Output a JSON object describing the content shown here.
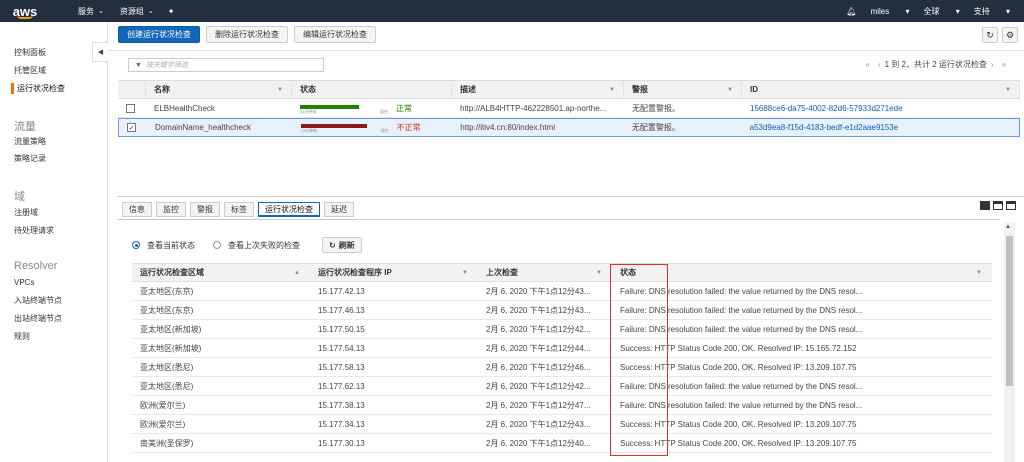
{
  "topnav": {
    "logo": "aws",
    "services": "服务",
    "resource_groups": "资源组",
    "user": "miles",
    "region": "全球",
    "support": "支持"
  },
  "sidebar": {
    "items": [
      {
        "label": "控制面板"
      },
      {
        "label": "托管区域"
      },
      {
        "label": "运行状况检查"
      },
      {
        "label": "流量策略"
      },
      {
        "label": "策略记录"
      },
      {
        "label": "注册域"
      },
      {
        "label": "待处理请求"
      },
      {
        "label": "VPCs"
      },
      {
        "label": "入站终端节点"
      },
      {
        "label": "出站终端节点"
      },
      {
        "label": "规则"
      }
    ],
    "sections": [
      "流量",
      "域",
      "Resolver"
    ]
  },
  "toolbar": {
    "create": "创建运行状况检查",
    "delete": "删除运行状况检查",
    "edit": "编辑运行状况检查"
  },
  "filter": {
    "placeholder": "按关键字筛选"
  },
  "pager": {
    "text": "1 到 2，共计 2 运行状况检查"
  },
  "top_table": {
    "headers": [
      "名称",
      "状态",
      "描述",
      "警报",
      "ID"
    ],
    "rows": [
      {
        "name": "ELBHealthCheck",
        "bar_left": "31分钟前",
        "bar_right": "现在",
        "status": "正常",
        "desc": "http://ALB4HTTP-462228501.ap-northe...",
        "alarm": "无配置警报。",
        "id": "15688ce6-da75-4002-82d6-57933d271ede",
        "health": 0.9,
        "color": "#1d8102",
        "checked": false
      },
      {
        "name": "DomainName_healthcheck",
        "bar_left": "15分钟前",
        "bar_right": "现在",
        "status": "不正常",
        "desc": "http://itiv4.cn:80/index.html",
        "alarm": "无配置警报。",
        "id": "a53d9ea8-f15d-4183-bedf-e1d2aae9153e",
        "health": 0.0,
        "color": "#8b1a1a",
        "checked": true
      }
    ]
  },
  "tabs": [
    "信息",
    "监控",
    "警报",
    "标签",
    "运行状况检查",
    "延迟"
  ],
  "radios": {
    "current": "查看当前状态",
    "last_fail": "查看上次失败的检查",
    "refresh": "刷新"
  },
  "bottom_table": {
    "headers": [
      "运行状况检查区域",
      "运行状况检查程序 IP",
      "上次检查",
      "状态"
    ],
    "rows": [
      {
        "region": "亚太地区(东京)",
        "ip": "15.177.42.13",
        "last": "2月 6, 2020 下午1点12分43...",
        "status": "Failure: DNS resolution failed: the value returned by the DNS resol..."
      },
      {
        "region": "亚太地区(东京)",
        "ip": "15.177.46.13",
        "last": "2月 6, 2020 下午1点12分43...",
        "status": "Failure: DNS resolution failed: the value returned by the DNS resol..."
      },
      {
        "region": "亚太地区(新加坡)",
        "ip": "15.177.50.15",
        "last": "2月 6, 2020 下午1点12分42...",
        "status": "Failure: DNS resolution failed: the value returned by the DNS resol..."
      },
      {
        "region": "亚太地区(新加坡)",
        "ip": "15.177.54.13",
        "last": "2月 6, 2020 下午1点12分44...",
        "status": "Success: HTTP Status Code 200, OK. Resolved IP: 15.165.72.152"
      },
      {
        "region": "亚太地区(悉尼)",
        "ip": "15.177.58.13",
        "last": "2月 6, 2020 下午1点12分46...",
        "status": "Success: HTTP Status Code 200, OK. Resolved IP: 13.209.107.75"
      },
      {
        "region": "亚太地区(悉尼)",
        "ip": "15.177.62.13",
        "last": "2月 6, 2020 下午1点12分42...",
        "status": "Failure: DNS resolution failed: the value returned by the DNS resol..."
      },
      {
        "region": "欧洲(爱尔兰)",
        "ip": "15.177.38.13",
        "last": "2月 6, 2020 下午1点12分47...",
        "status": "Failure: DNS resolution failed: the value returned by the DNS resol..."
      },
      {
        "region": "欧洲(爱尔兰)",
        "ip": "15.177.34.13",
        "last": "2月 6, 2020 下午1点12分43...",
        "status": "Success: HTTP Status Code 200, OK. Resolved IP: 13.209.107.75"
      },
      {
        "region": "南美洲(圣保罗)",
        "ip": "15.177.30.13",
        "last": "2月 6, 2020 下午1点12分40...",
        "status": "Success: HTTP Status Code 200, OK. Resolved IP: 13.209.107.75"
      }
    ]
  }
}
